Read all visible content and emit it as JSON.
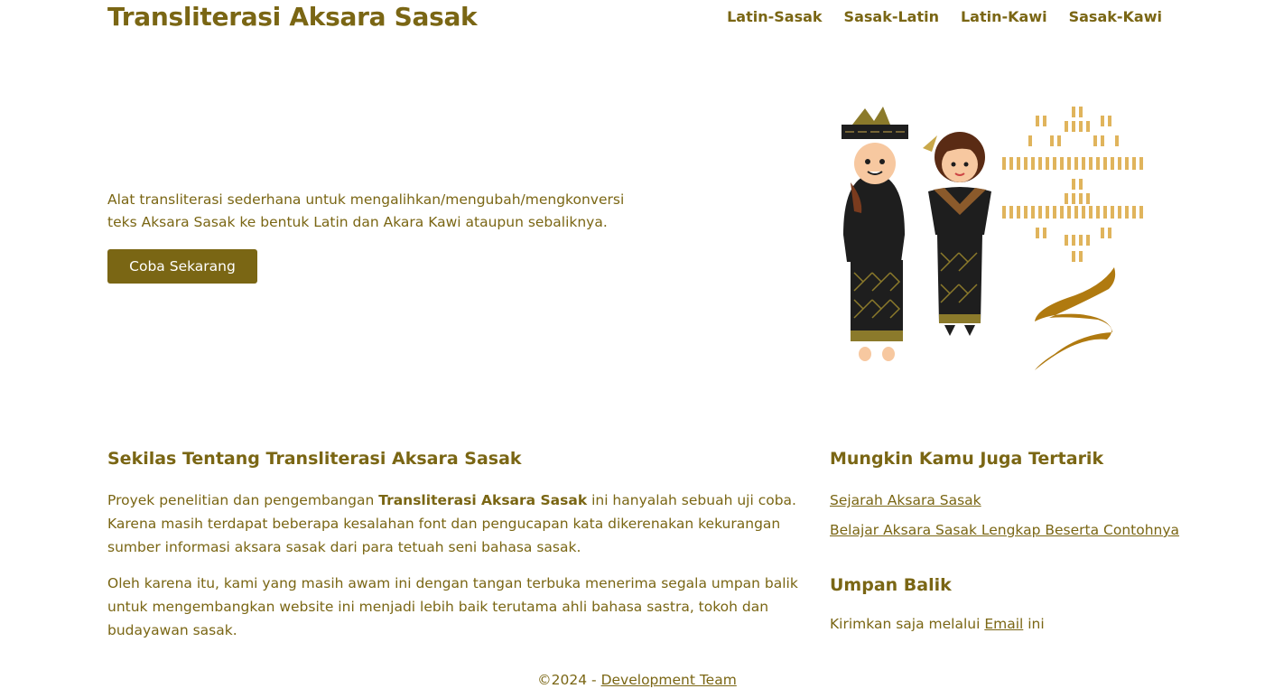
{
  "header": {
    "title": "Transliterasi Aksara Sasak",
    "nav": [
      "Latin-Sasak",
      "Sasak-Latin",
      "Latin-Kawi",
      "Sasak-Kawi"
    ]
  },
  "hero": {
    "description": "Alat transliterasi sederhana untuk mengalihkan/mengubah/mengkonversi teks Aksara Sasak ke bentuk Latin dan Akara Kawi ataupun sebaliknya.",
    "button": "Coba Sekarang"
  },
  "about": {
    "title": "Sekilas Tentang Transliterasi Aksara Sasak",
    "p1_before": "Proyek penelitian dan pengembangan ",
    "p1_bold": "Transliterasi Aksara Sasak",
    "p1_after": " ini hanyalah sebuah uji coba. Karena masih terdapat beberapa kesalahan font dan pengucapan kata dikerenakan kekurangan sumber informasi aksara sasak dari para tetuah seni bahasa sasak.",
    "p2": "Oleh karena itu, kami yang masih awam ini dengan tangan terbuka menerima segala umpan balik untuk mengembangkan website ini menjadi lebih baik terutama ahli bahasa sastra, tokoh dan budayawan sasak."
  },
  "sidebar": {
    "related_title": "Mungkin Kamu Juga Tertarik",
    "links": [
      "Sejarah Aksara Sasak",
      "Belajar Aksara Sasak Lengkap Beserta Contohnya"
    ],
    "feedback_title": "Umpan Balik",
    "feedback_before": "Kirimkan saja melalui ",
    "feedback_link": "Email",
    "feedback_after": " ini"
  },
  "footer": {
    "copyright": "©2024 - ",
    "link": "Development Team"
  },
  "colors": {
    "primary": "#7a6614",
    "gold": "#e0b45c",
    "black": "#1e1e1e"
  }
}
